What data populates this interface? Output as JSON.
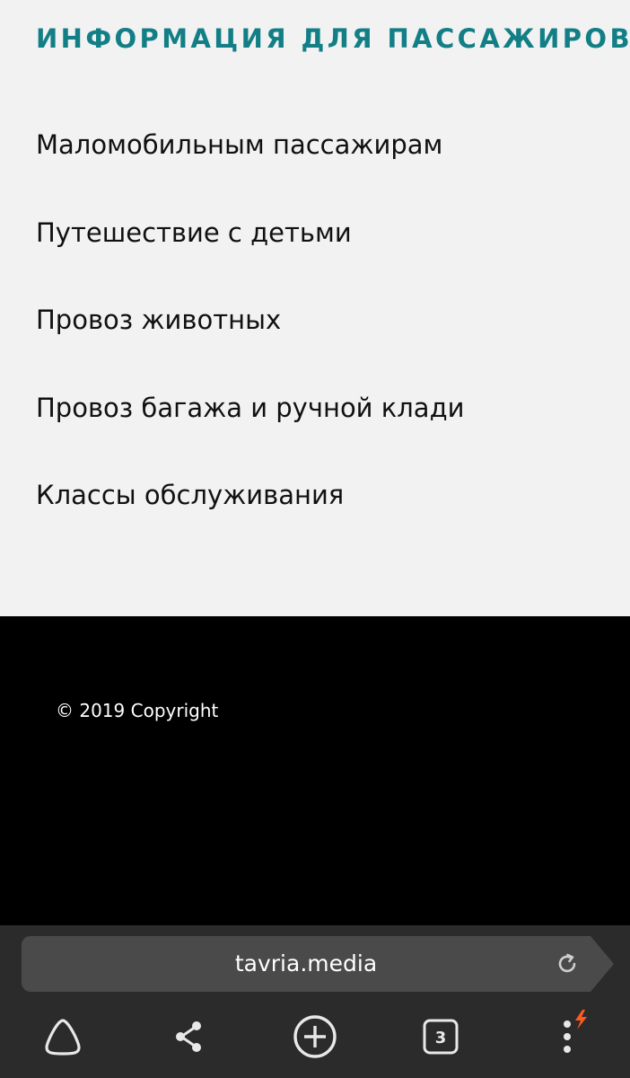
{
  "info": {
    "title": "ИНФОРМАЦИЯ ДЛЯ ПАССАЖИРОВ",
    "items": [
      {
        "label": "Маломобильным пассажирам"
      },
      {
        "label": "Путешествие с детьми"
      },
      {
        "label": "Провоз животных"
      },
      {
        "label": "Провоз багажа и ручной клади"
      },
      {
        "label": "Классы обслуживания"
      }
    ]
  },
  "footer": {
    "copyright": "© 2019 Copyright"
  },
  "browser": {
    "url": "tavria.media",
    "tab_count": "3",
    "nav_icons": [
      "alice-icon",
      "share-icon",
      "new-tab-icon",
      "tabs-icon",
      "menu-icon"
    ]
  },
  "colors": {
    "title": "#127f86",
    "section_bg": "#f2f2f2",
    "footer_bg": "#000000",
    "browser_bg": "#2b2b2b",
    "address_bg": "#4a4a4a",
    "accent_bolt": "#ff5a1f"
  }
}
